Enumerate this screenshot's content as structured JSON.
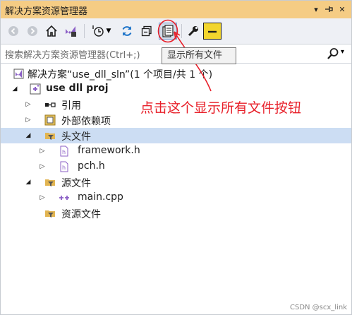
{
  "window": {
    "title": "解决方案资源管理器"
  },
  "title_buttons": {
    "dropdown": "▾",
    "pin": "⊣",
    "close": "✕"
  },
  "search": {
    "placeholder": "搜索解决方案资源管理器(Ctrl+;)"
  },
  "tooltip": {
    "text": "显示所有文件"
  },
  "tree": {
    "solution": "解决方案“use_dll_sln”(1 个项目/共 1 个)",
    "project": "use dll proj",
    "references": "引用",
    "external_deps": "外部依赖项",
    "header_files": "头文件",
    "framework_h": "framework.h",
    "pch_h": "pch.h",
    "source_files": "源文件",
    "main_cpp": "main.cpp",
    "resource_files": "资源文件"
  },
  "annotation": {
    "text": "点击这个显示所有文件按钮"
  },
  "watermark": {
    "text": "CSDN @scx_link"
  },
  "colors": {
    "titlebar": "#f5cc84",
    "selection": "#ccddf3",
    "annotation": "#e8202a",
    "accent_blue": "#1e74c9"
  }
}
